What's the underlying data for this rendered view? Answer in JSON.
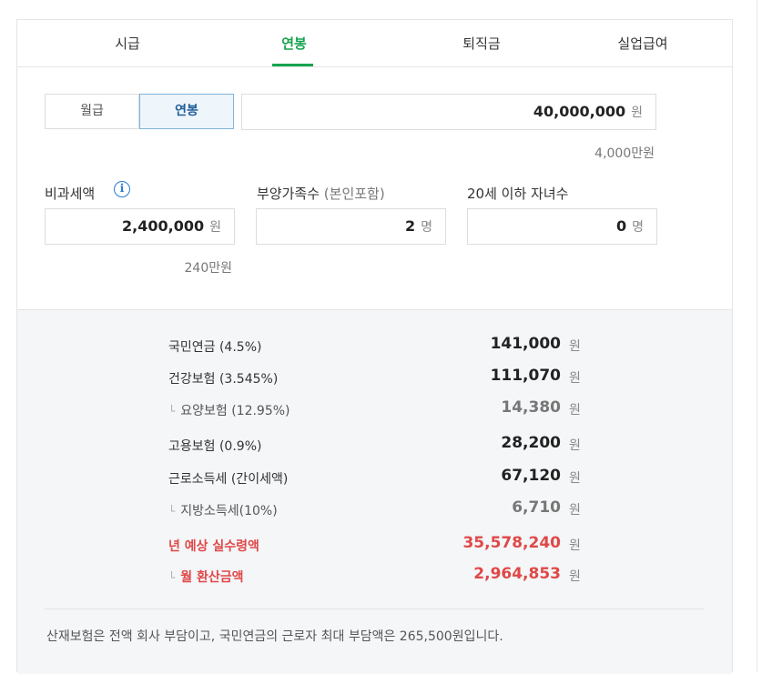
{
  "tabs": [
    {
      "label": "시급"
    },
    {
      "label": "연봉"
    },
    {
      "label": "퇴직금"
    },
    {
      "label": "실업급여"
    }
  ],
  "pay_type": {
    "monthly": "월급",
    "annual": "연봉"
  },
  "salary": {
    "value": "40,000,000",
    "unit": "원",
    "hint": "4,000만원"
  },
  "nontaxable": {
    "label": "비과세액",
    "value": "2,400,000",
    "unit": "원",
    "hint": "240만원"
  },
  "dependents": {
    "label": "부양가족수",
    "label_sub": "(본인포함)",
    "value": "2",
    "unit": "명"
  },
  "children": {
    "label": "20세 이하 자녀수",
    "value": "0",
    "unit": "명"
  },
  "results": [
    {
      "name": "국민연금 (4.5%)",
      "amount": "141,000",
      "unit": "원"
    },
    {
      "name": "건강보험 (3.545%)",
      "amount": "111,070",
      "unit": "원"
    },
    {
      "name": "요양보험 (12.95%)",
      "amount": "14,380",
      "unit": "원"
    },
    {
      "name": "고용보험 (0.9%)",
      "amount": "28,200",
      "unit": "원"
    },
    {
      "name": "근로소득세 (간이세액)",
      "amount": "67,120",
      "unit": "원"
    },
    {
      "name": "지방소득세(10%)",
      "amount": "6,710",
      "unit": "원"
    },
    {
      "name": "년 예상 실수령액",
      "amount": "35,578,240",
      "unit": "원"
    },
    {
      "name": "월 환산금액",
      "amount": "2,964,853",
      "unit": "원"
    }
  ],
  "note": "산재보험은 전액 회사 부담이고, 국민연금의 근로자 최대 부담액은 265,500원입니다.",
  "colors": {
    "accent_green": "#17a44f",
    "highlight_red": "#e04848",
    "selected_blue": "#1f5f99"
  }
}
